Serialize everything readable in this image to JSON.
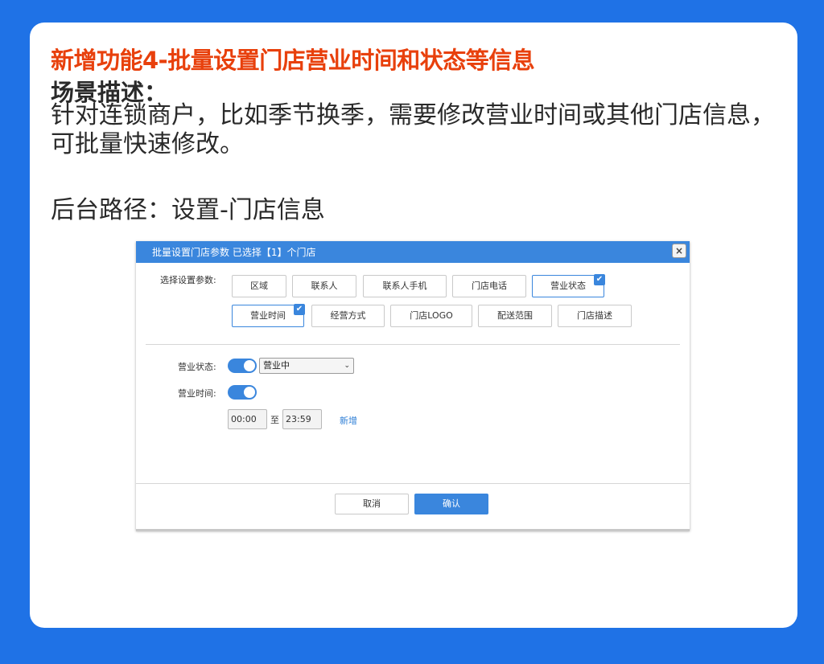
{
  "slide": {
    "title": "新增功能4-批量设置门店营业时间和状态等信息",
    "scene_heading": "场景描述：",
    "scene_desc": "针对连锁商户，比如季节换季，需要修改营业时间或其他门店信息，可批量快速修改。",
    "path_line": "后台路径：设置-门店信息"
  },
  "dialog": {
    "title": "批量设置门店参数    已选择【1】个门店",
    "close_glyph": "×",
    "params_label": "选择设置参数:",
    "options": [
      {
        "label": "区域",
        "checked": false
      },
      {
        "label": "联系人",
        "checked": false
      },
      {
        "label": "联系人手机",
        "checked": false
      },
      {
        "label": "门店电话",
        "checked": false
      },
      {
        "label": "营业状态",
        "checked": true
      },
      {
        "label": "营业时间",
        "checked": true
      },
      {
        "label": "经营方式",
        "checked": false
      },
      {
        "label": "门店LOGO",
        "checked": false
      },
      {
        "label": "配送范围",
        "checked": false
      },
      {
        "label": "门店描述",
        "checked": false
      }
    ],
    "check_glyph": "✔",
    "status_label": "营业状态:",
    "status_toggle_on": true,
    "status_value": "营业中",
    "hours_label": "营业时间:",
    "hours_toggle_on": true,
    "start_time": "00:00",
    "to_label": "至",
    "end_time": "23:59",
    "add_link": "新增",
    "cancel_label": "取消",
    "confirm_label": "确认"
  },
  "colors": {
    "background": "#1f72e6",
    "title_accent": "#e8400c",
    "dialog_primary": "#3a86dd"
  }
}
